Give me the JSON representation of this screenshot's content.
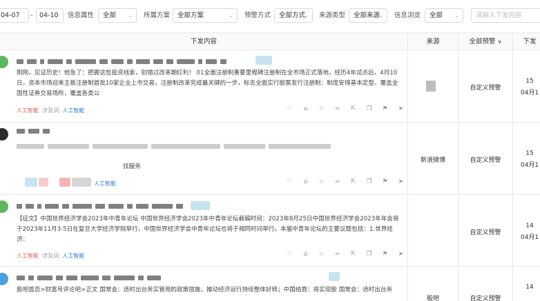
{
  "filters": {
    "date_start": "04-07",
    "date_sep": "-",
    "date_end": "04-10",
    "info_attr_label": "信息属性",
    "info_attr_value": "全部",
    "scheme_label": "所属方案",
    "scheme_value": "全部方案",
    "warn_method_label": "预警方式",
    "warn_method_value": "全部方式",
    "source_type_label": "来源类型",
    "source_type_value": "全部来源",
    "browse_label": "信息浏览",
    "browse_value": "全部",
    "search_placeholder": "请输入下发内容"
  },
  "table": {
    "col_content": "下发内容",
    "col_source": "来源",
    "col_warning": "全部预警",
    "col_time": "下发"
  },
  "rows": [
    {
      "text": "刚刚，见证历史！他急了：把握这些投资线索，别错过改革期红利！ 01全面注册制重要里程碑注册制在全市场正式落地，经历4年试点后，4月10日，资本市场迎来主板注册制首批10家企业上市交易，注册制改革完成最关键的一步，标志全面实行股票发行注册制：制度安排基本定型、覆盖全国性证券交易场所，覆盖各类公",
      "tag_a": "人工智能",
      "tag_b": "涉及词:",
      "tag_c": "人工智能",
      "source": "",
      "warning": "自定义预警",
      "time_a": "15",
      "time_b": "04月1"
    },
    {
      "text": "找服务",
      "tag_c": "人工智能",
      "source": "新浪微博",
      "warning": "自定义预警",
      "time_a": "15",
      "time_b": "04月1"
    },
    {
      "text": "【征文】中国世界经济学会2023年中青年论坛 中国世界经济学会2023年中青年论坛截稿时间：2023年8月25日中国世界经济学会2023年年会将于2023年11月3-5日在复旦大学经济学院举行，中国世界经济学会中青年论坛也将于相同时间举行。本届中青年论坛的主要议题包括：1.世界经济：",
      "tag_a": "人工智能",
      "tag_b": "涉及词:",
      "tag_c": "人工智能",
      "source": "",
      "warning": "自定义预警",
      "time_a": "14",
      "time_b": "04月1"
    },
    {
      "text": "股吧首页>财富号评论吧>正文 国常会：适时出台务实管用的政策措施，推动经济运行持续整体好转；中国结算：将实现股 国常会：适时出台务",
      "source": "股吧",
      "warning": "自定义预警",
      "time_a": "14"
    }
  ],
  "icons": [
    "heart-icon",
    "tag-icon",
    "star-icon",
    "link-icon",
    "share-icon",
    "copy-icon",
    "bookmark-icon",
    "send-icon"
  ],
  "colors": {
    "tag_blue": "#2b7bd6",
    "tag_red": "#e35a4d",
    "highlight": "#b8dcef"
  }
}
